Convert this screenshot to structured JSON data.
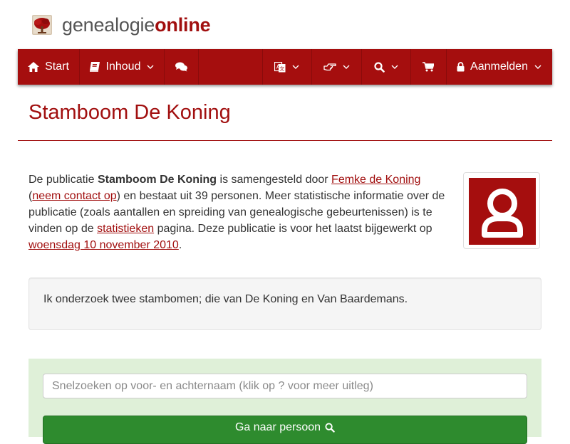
{
  "brand": {
    "name_prefix": "genealogie",
    "name_suffix": "online"
  },
  "colors": {
    "brand_red": "#a50e0e",
    "link_red": "#a10f0f",
    "search_panel_green": "#dff0d8",
    "button_green": "#2e8b2e"
  },
  "nav": {
    "items": [
      {
        "label": "Start",
        "icon": "home-icon"
      },
      {
        "label": "Inhoud",
        "icon": "book-icon",
        "has_dropdown": true
      },
      {
        "label": "",
        "icon": "comments-icon"
      },
      {
        "label": "",
        "icon": "language-icon",
        "has_dropdown": true
      },
      {
        "label": "",
        "icon": "hand-pointer-icon",
        "has_dropdown": true
      },
      {
        "label": "",
        "icon": "search-icon",
        "has_dropdown": true
      },
      {
        "label": "",
        "icon": "cart-icon"
      },
      {
        "label": "Aanmelden",
        "icon": "lock-icon",
        "has_dropdown": true
      }
    ]
  },
  "page": {
    "title": "Stamboom De Koning"
  },
  "intro": {
    "t1": "De publicatie ",
    "publication": "Stamboom De Koning",
    "t2": " is samengesteld door ",
    "author": "Femke de Koning",
    "t3": "(",
    "contact": "neem contact op",
    "t4": ") en bestaat uit 39 personen. Meer statistische informatie over de publicatie (zoals aantallen en spreiding van genealogische gebeurtenissen) is te vinden op de ",
    "stats": "statistieken",
    "t5": " pagina. Deze publicatie is voor het laatst bijgewerkt op ",
    "updated": "woensdag 10 november 2010",
    "t6": "."
  },
  "avatar": {
    "icon": "user-avatar-icon"
  },
  "description": {
    "text": "Ik onderzoek twee stambomen; die van De Koning en Van Baardemans."
  },
  "search": {
    "placeholder": "Snelzoeken op voor- en achternaam (klik op ? voor meer uitleg)",
    "button_label": "Ga naar persoon"
  }
}
